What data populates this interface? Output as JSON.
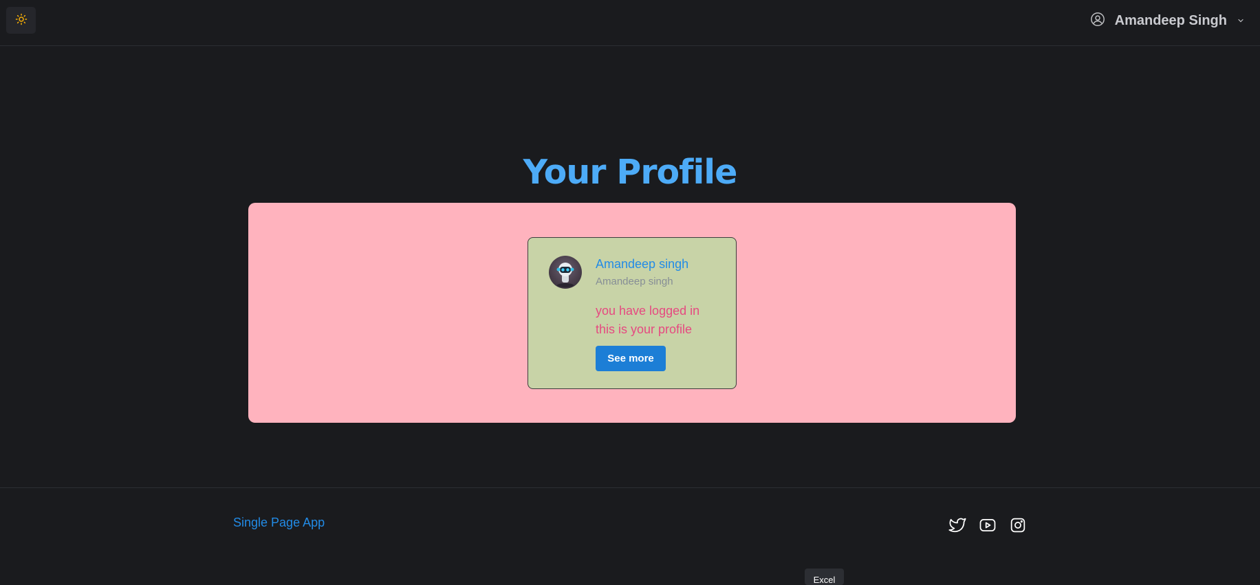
{
  "header": {
    "theme_toggle_icon": "sun-icon",
    "user": {
      "name": "Amandeep Singh",
      "icon": "user-circle-icon",
      "dropdown_icon": "chevron-down-icon"
    }
  },
  "main": {
    "title": "Your Profile",
    "card": {
      "name": "Amandeep singh",
      "username": "Amandeep singh",
      "message": "you have logged in this is your profile",
      "button_label": "See more"
    }
  },
  "footer": {
    "brand": "Single Page App",
    "social_icons": [
      "twitter-icon",
      "youtube-icon",
      "instagram-icon"
    ]
  },
  "tooltip": {
    "text": "Excel"
  },
  "colors": {
    "background": "#1a1b1e",
    "accent": "#4dabf7",
    "link": "#228be6",
    "panel": "#ffb3be",
    "card": "#c8d3a7",
    "message": "#e64980",
    "button": "#1c7ed6",
    "sun": "#fab005"
  }
}
